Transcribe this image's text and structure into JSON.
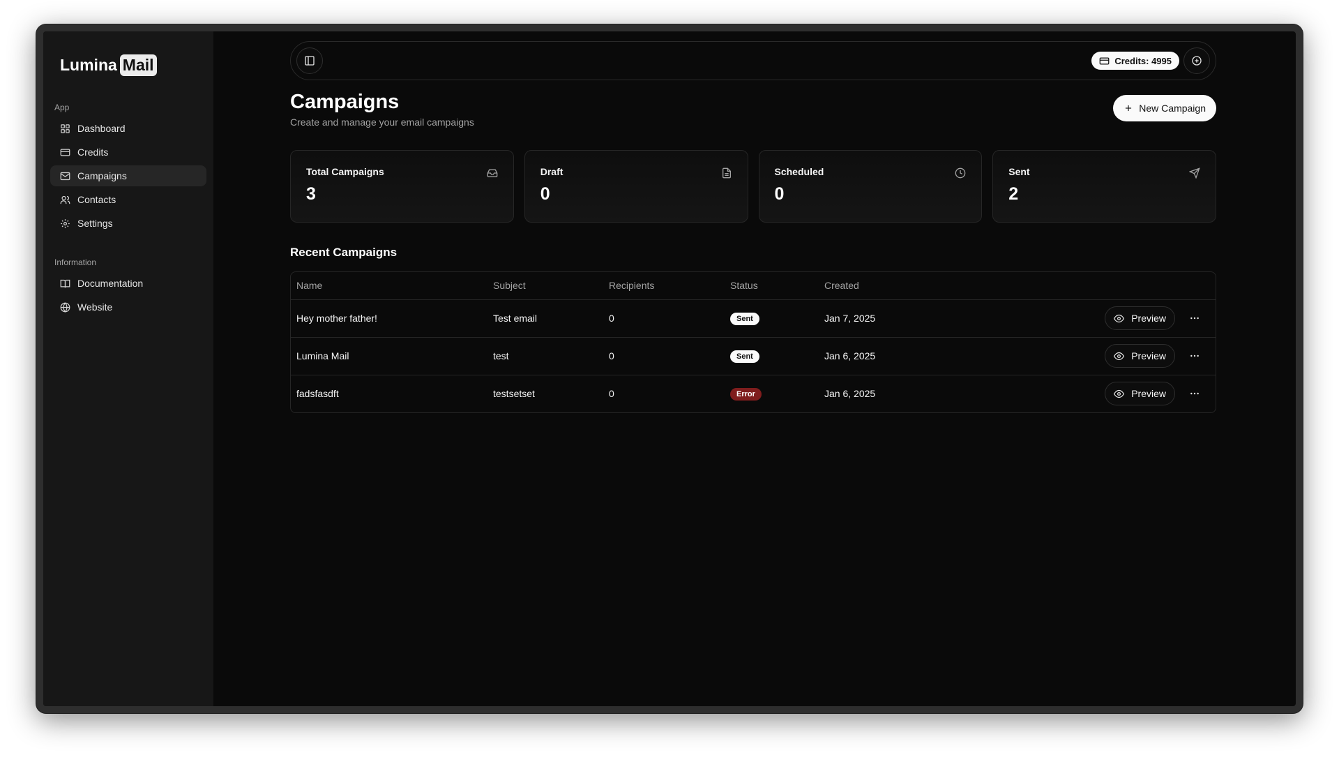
{
  "brand": {
    "name": "Lumina",
    "badge": "Mail"
  },
  "sidebar": {
    "sections": [
      {
        "label": "App",
        "items": [
          {
            "label": "Dashboard",
            "icon": "grid-icon",
            "active": false
          },
          {
            "label": "Credits",
            "icon": "credit-card-icon",
            "active": false
          },
          {
            "label": "Campaigns",
            "icon": "mail-icon",
            "active": true
          },
          {
            "label": "Contacts",
            "icon": "users-icon",
            "active": false
          },
          {
            "label": "Settings",
            "icon": "gear-icon",
            "active": false
          }
        ]
      },
      {
        "label": "Information",
        "items": [
          {
            "label": "Documentation",
            "icon": "book-icon",
            "active": false
          },
          {
            "label": "Website",
            "icon": "globe-icon",
            "active": false
          }
        ]
      }
    ]
  },
  "topbar": {
    "credits_label": "Credits: 4995"
  },
  "page": {
    "title": "Campaigns",
    "subtitle": "Create and manage your email campaigns",
    "new_button": "New Campaign"
  },
  "stats": [
    {
      "label": "Total Campaigns",
      "value": "3",
      "icon": "inbox-icon"
    },
    {
      "label": "Draft",
      "value": "0",
      "icon": "file-icon"
    },
    {
      "label": "Scheduled",
      "value": "0",
      "icon": "clock-icon"
    },
    {
      "label": "Sent",
      "value": "2",
      "icon": "send-icon"
    }
  ],
  "recent": {
    "title": "Recent Campaigns",
    "columns": [
      "Name",
      "Subject",
      "Recipients",
      "Status",
      "Created"
    ],
    "rows": [
      {
        "name": "Hey mother father!",
        "subject": "Test email",
        "recipients": "0",
        "status": "Sent",
        "created": "Jan 7, 2025",
        "action": "Preview"
      },
      {
        "name": "Lumina Mail",
        "subject": "test",
        "recipients": "0",
        "status": "Sent",
        "created": "Jan 6, 2025",
        "action": "Preview"
      },
      {
        "name": "fadsfasdft",
        "subject": "testsetset",
        "recipients": "0",
        "status": "Error",
        "created": "Jan 6, 2025",
        "action": "Preview"
      }
    ]
  },
  "colors": {
    "background": "#0a0a0a",
    "sidebar": "#171717",
    "error": "#7f1d1d",
    "accent": "#fafafa"
  }
}
